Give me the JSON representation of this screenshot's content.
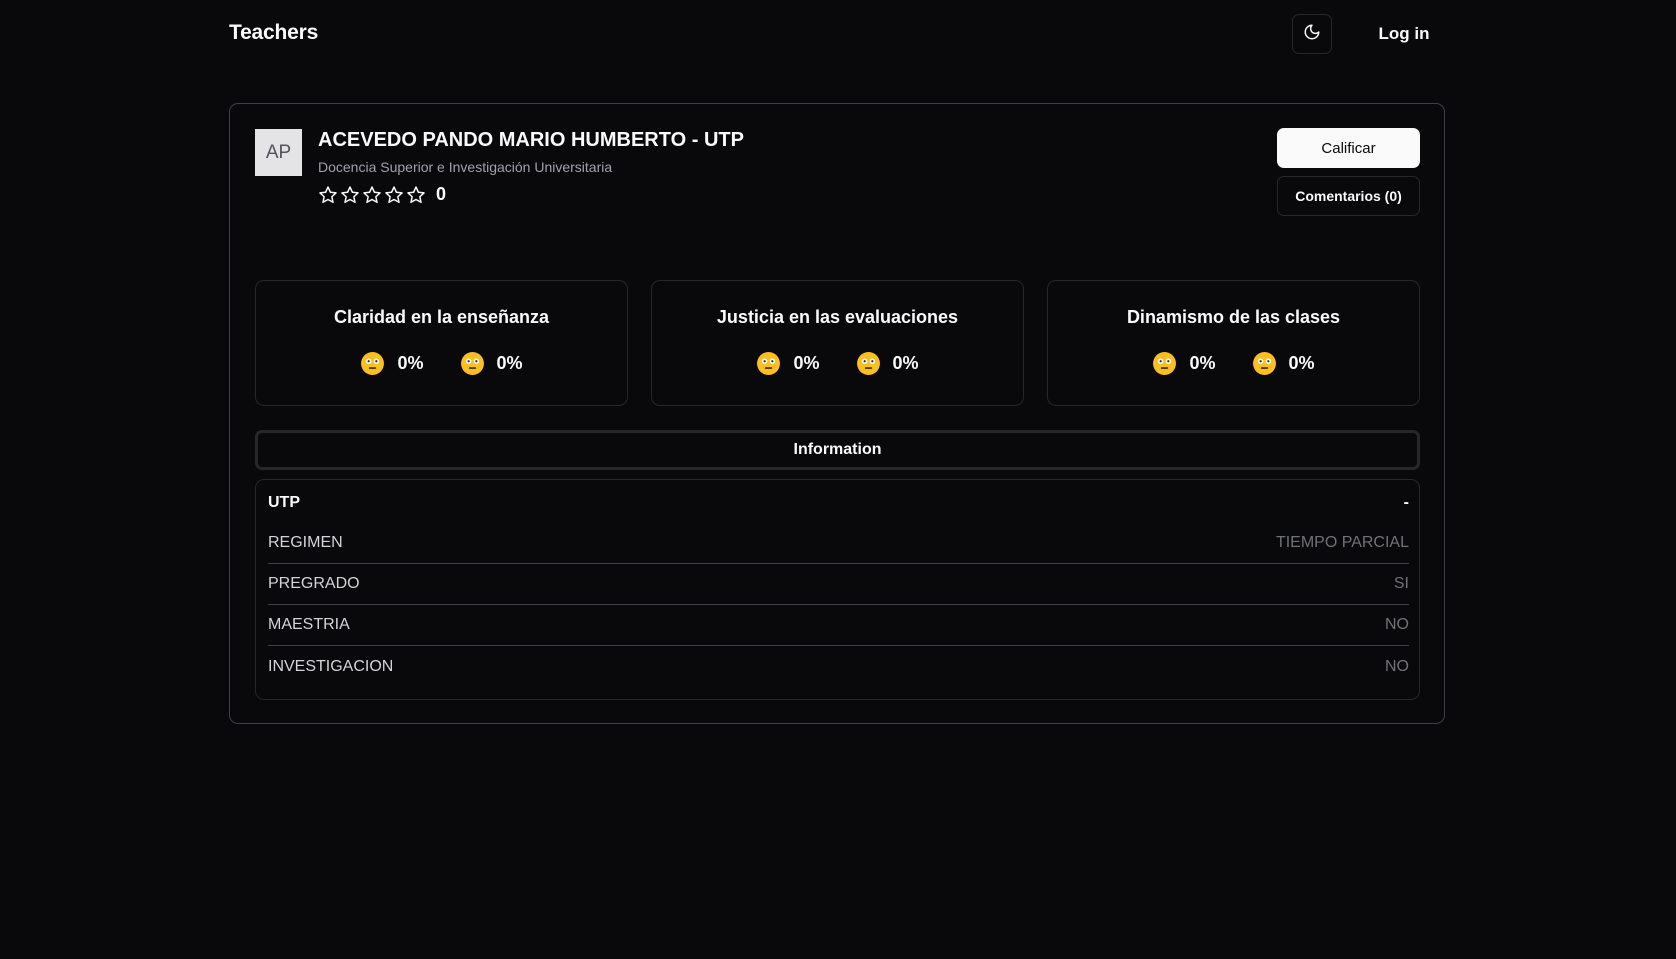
{
  "header": {
    "brand": "Teachers",
    "theme_icon": "moon-icon",
    "login_label": "Log in"
  },
  "teacher": {
    "initials": "AP",
    "name": "ACEVEDO PANDO MARIO HUMBERTO - UTP",
    "department": "Docencia Superior e Investigación Universitaria",
    "rating": {
      "stars_filled": 0,
      "stars_total": 5,
      "count": "0"
    }
  },
  "actions": {
    "rate_label": "Calificar",
    "comments_label": "Comentarios (0)"
  },
  "metrics": [
    {
      "title": "Claridad en la enseñanza",
      "values": [
        "0%",
        "0%"
      ]
    },
    {
      "title": "Justicia en las evaluaciones",
      "values": [
        "0%",
        "0%"
      ]
    },
    {
      "title": "Dinamismo de las clases",
      "values": [
        "0%",
        "0%"
      ]
    }
  ],
  "info": {
    "tab_label": "Information",
    "header": {
      "label": "UTP",
      "value": "-"
    },
    "rows": [
      {
        "label": "REGIMEN",
        "value": "TIEMPO PARCIAL"
      },
      {
        "label": "PREGRADO",
        "value": "SI"
      },
      {
        "label": "MAESTRIA",
        "value": "NO"
      },
      {
        "label": "INVESTIGACION",
        "value": "NO"
      }
    ]
  },
  "colors": {
    "background": "#09090b",
    "foreground": "#fafafa",
    "border": "#27272a",
    "muted": "#a1a1aa",
    "emoji": "#fbbf24"
  }
}
